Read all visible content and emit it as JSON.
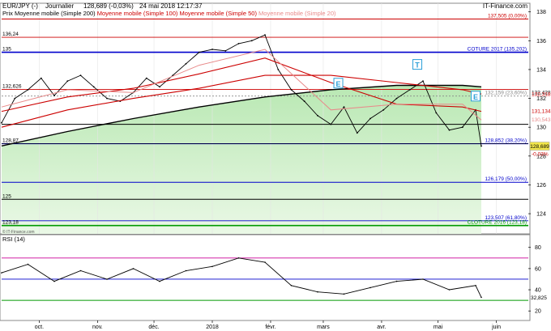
{
  "header": {
    "symbol": "EUR/JPY (-)",
    "period": "Journalier",
    "quote": "128,689 (-0,03%)",
    "datetime": "24 mai 2018 12:17:37",
    "source": "IT-Finance.com"
  },
  "legend": [
    {
      "label": "Prix",
      "color": "#000000"
    },
    {
      "label": "Moyenne mobile (Simple 200)",
      "color": "#000000"
    },
    {
      "label": "Moyenne mobile (Simple 100)",
      "color": "#cc0000"
    },
    {
      "label": "Moyenne mobile (Simple 50)",
      "color": "#cc0000"
    },
    {
      "label": "Moyenne mobile (Simple 20)",
      "color": "#e88a8a"
    }
  ],
  "rsi_label": "RSI (14)",
  "copyright": "© IT-Finance.com",
  "chart_data": {
    "type": "line",
    "price_axis": {
      "ylim": [
        122.6,
        138.6
      ],
      "ticks": [
        124,
        126,
        128,
        130,
        132,
        134,
        136,
        138
      ]
    },
    "rsi_axis": {
      "ylim": [
        11,
        92
      ],
      "ticks": [
        20,
        40,
        60,
        80
      ]
    },
    "x_labels": [
      "oct.",
      "nov.",
      "déc.",
      "2018",
      "févr.",
      "mars",
      "avr.",
      "mai",
      "juin"
    ],
    "x_label_dates": [
      "2017-10-01",
      "2017-11-01",
      "2017-12-01",
      "2018-01-01",
      "2018-02-01",
      "2018-03-01",
      "2018-04-01",
      "2018-05-01",
      "2018-06-01"
    ],
    "x_range": [
      "2017-09-11",
      "2018-06-18"
    ],
    "last_price": "128,689",
    "last_change": "-0,03%",
    "levels": [
      {
        "value": 137.505,
        "label": "137,505 (0,00%)",
        "color": "#cc0000",
        "label_side": "right",
        "style": "line"
      },
      {
        "value": 136.24,
        "label": "136,24",
        "color": "#cc0000",
        "label_side": "left",
        "style": "line"
      },
      {
        "value": 135.202,
        "label": "COTURE 2017 (135,202)",
        "color": "#0000cc",
        "label_side": "right",
        "style": "thick",
        "left_label": "135"
      },
      {
        "value": 132.626,
        "label": "132,626",
        "color": "#cc0000",
        "label_side": "left",
        "style": "line"
      },
      {
        "value": 132.428,
        "label": "132,428",
        "color": "#000000",
        "label_side": "axis",
        "style": "none"
      },
      {
        "value": 132.159,
        "label": "132,159 (23,60%)",
        "color": "#888888",
        "label_side": "right",
        "style": "dotted"
      },
      {
        "value": 132.318,
        "label": "132,318",
        "color": "#cc0000",
        "label_side": "axis",
        "style": "none"
      },
      {
        "value": 131.134,
        "label": "131,134",
        "color": "#cc0000",
        "label_side": "axis",
        "style": "none"
      },
      {
        "value": 130.543,
        "label": "130,543",
        "color": "#e88a8a",
        "label_side": "axis",
        "style": "none"
      },
      {
        "value": 130.2,
        "label": "",
        "color": "#000000",
        "label_side": "none",
        "style": "line"
      },
      {
        "value": 128.852,
        "label": "128,852 (38,20%)",
        "color": "#0000cc",
        "label_side": "right",
        "style": "line"
      },
      {
        "value": 128.87,
        "label": "128,87",
        "color": "#000000",
        "label_side": "left",
        "style": "thin"
      },
      {
        "value": 126.179,
        "label": "126,179 (50,00%)",
        "color": "#0000cc",
        "label_side": "right",
        "style": "line"
      },
      {
        "value": 125.0,
        "label": "125",
        "color": "#000000",
        "label_side": "left",
        "style": "line"
      },
      {
        "value": 123.507,
        "label": "123,507 (61,80%)",
        "color": "#0000cc",
        "label_side": "right",
        "style": "line"
      },
      {
        "value": 123.18,
        "label": "CLOTURE 2016 (123,18)",
        "color": "#009900",
        "label_side": "right",
        "style": "thick",
        "left_label": "123,18"
      }
    ],
    "series": [
      {
        "name": "Prix",
        "color": "#000000",
        "dates": [
          "2017-09-11",
          "2017-09-18",
          "2017-09-25",
          "2017-10-02",
          "2017-10-09",
          "2017-10-16",
          "2017-10-23",
          "2017-10-30",
          "2017-11-06",
          "2017-11-13",
          "2017-11-20",
          "2017-11-27",
          "2017-12-04",
          "2017-12-11",
          "2017-12-18",
          "2017-12-25",
          "2018-01-01",
          "2018-01-08",
          "2018-01-15",
          "2018-01-22",
          "2018-01-29",
          "2018-02-05",
          "2018-02-12",
          "2018-02-19",
          "2018-02-26",
          "2018-03-05",
          "2018-03-12",
          "2018-03-19",
          "2018-03-26",
          "2018-04-02",
          "2018-04-09",
          "2018-04-16",
          "2018-04-23",
          "2018-04-30",
          "2018-05-07",
          "2018-05-14",
          "2018-05-21",
          "2018-05-24"
        ],
        "values": [
          130.3,
          132.0,
          132.6,
          133.4,
          132.2,
          133.2,
          133.6,
          132.8,
          132.0,
          131.8,
          132.4,
          133.4,
          132.8,
          133.6,
          134.4,
          135.2,
          135.4,
          135.3,
          135.8,
          136.0,
          136.4,
          134.0,
          132.6,
          131.8,
          130.8,
          130.2,
          131.4,
          129.6,
          130.6,
          131.2,
          132.0,
          132.6,
          133.2,
          131.0,
          129.8,
          130.0,
          131.2,
          128.689
        ]
      },
      {
        "name": "Moyenne mobile (Simple 200)",
        "color": "#000000",
        "dates": [
          "2017-09-11",
          "2017-10-16",
          "2017-11-20",
          "2017-12-25",
          "2018-01-29",
          "2018-03-05",
          "2018-04-09",
          "2018-05-14",
          "2018-05-24"
        ],
        "values": [
          128.7,
          129.7,
          130.6,
          131.4,
          132.1,
          132.6,
          132.9,
          132.9,
          132.8
        ]
      },
      {
        "name": "Moyenne mobile (Simple 100)",
        "color": "#cc0000",
        "dates": [
          "2017-09-11",
          "2017-10-16",
          "2017-11-20",
          "2017-12-25",
          "2018-01-29",
          "2018-03-05",
          "2018-04-09",
          "2018-05-14",
          "2018-05-24"
        ],
        "values": [
          130.0,
          131.2,
          132.0,
          132.7,
          133.6,
          133.6,
          133.1,
          132.6,
          132.3
        ]
      },
      {
        "name": "Moyenne mobile (Simple 50)",
        "color": "#cc0000",
        "dates": [
          "2017-09-11",
          "2017-10-16",
          "2017-11-20",
          "2017-12-25",
          "2018-01-29",
          "2018-03-05",
          "2018-04-09",
          "2018-05-14",
          "2018-05-24"
        ],
        "values": [
          131.1,
          132.1,
          132.7,
          133.7,
          134.8,
          133.1,
          131.6,
          131.4,
          131.1
        ]
      },
      {
        "name": "Moyenne mobile (Simple 20)",
        "color": "#e88a8a",
        "dates": [
          "2017-09-11",
          "2017-10-16",
          "2017-11-20",
          "2017-12-25",
          "2018-01-29",
          "2018-03-05",
          "2018-04-09",
          "2018-05-14",
          "2018-05-24"
        ],
        "values": [
          131.4,
          132.6,
          132.4,
          134.3,
          135.4,
          131.2,
          131.6,
          131.6,
          130.5
        ]
      }
    ],
    "annotations": [
      {
        "text": "E",
        "date": "2018-03-09",
        "value": 133.0
      },
      {
        "text": "T",
        "date": "2018-04-20",
        "value": 134.3
      },
      {
        "text": "E",
        "date": "2018-05-21",
        "value": 132.1
      }
    ],
    "rsi": {
      "name": "RSI (14)",
      "dates": [
        "2017-09-11",
        "2017-09-25",
        "2017-10-09",
        "2017-10-23",
        "2017-11-06",
        "2017-11-20",
        "2017-12-04",
        "2017-12-18",
        "2018-01-01",
        "2018-01-15",
        "2018-01-29",
        "2018-02-12",
        "2018-02-26",
        "2018-03-12",
        "2018-03-26",
        "2018-04-09",
        "2018-04-23",
        "2018-05-07",
        "2018-05-21",
        "2018-05-24"
      ],
      "values": [
        56,
        64,
        48,
        58,
        50,
        60,
        48,
        58,
        62,
        70,
        66,
        44,
        38,
        36,
        42,
        48,
        50,
        40,
        44,
        32.825
      ],
      "last_label": "32,825",
      "levels": [
        {
          "value": 70,
          "color": "#cc0099"
        },
        {
          "value": 50,
          "color": "#0000cc"
        },
        {
          "value": 30,
          "color": "#009900"
        }
      ]
    }
  }
}
